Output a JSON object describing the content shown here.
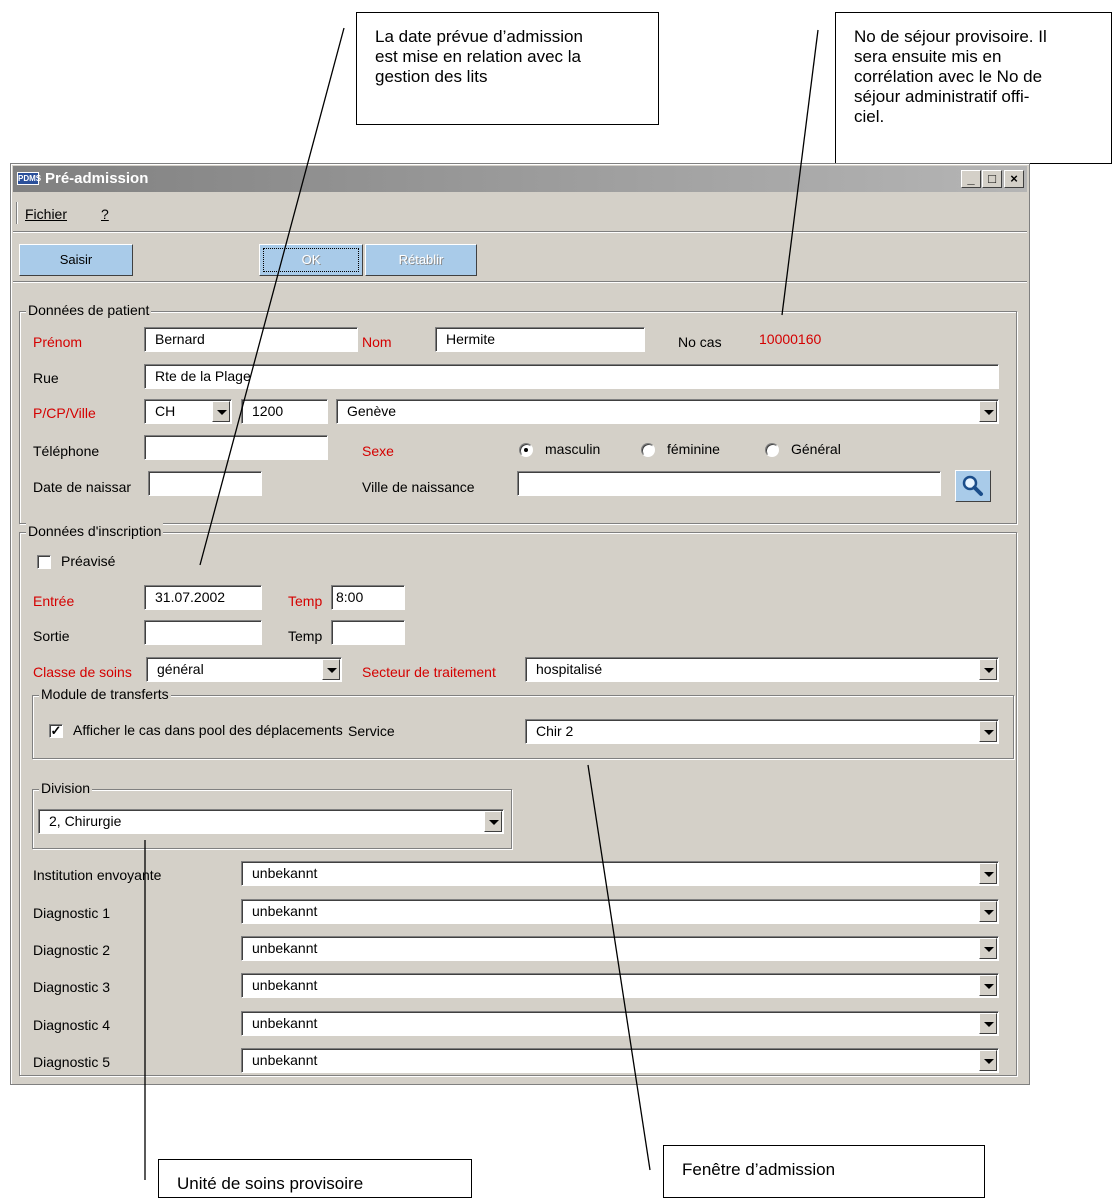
{
  "callouts": {
    "admission_date": "La date prévue d’admission\nest mise en relation avec la\ngestion des lits",
    "temp_stay": "No de séjour provisoire. Il\nsera ensuite mis en\ncorrélation avec le No de\nséjour administratif offi-\nciel.",
    "temp_unit": "Unité de soins provisoire",
    "admission_window": "Fenêtre d’admission"
  },
  "window": {
    "icon_text": "PDMS",
    "title": "Pré-admission",
    "controls": {
      "minimize": "_",
      "maximize": "□",
      "close": "×"
    }
  },
  "menu": {
    "file": "Fichier",
    "help": "?"
  },
  "toolbar": {
    "saisir": "Saisir",
    "ok": "OK",
    "retablir": "Rétablir"
  },
  "patient": {
    "legend": "Données de patient",
    "prenom_label": "Prénom",
    "prenom_value": "Bernard",
    "nom_label": "Nom",
    "nom_value": "Hermite",
    "nocas_label": "No cas",
    "nocas_value": "10000160",
    "rue_label": "Rue",
    "rue_value": "Rte de la Plage",
    "pcpville_label": "P/CP/Ville",
    "country": "CH",
    "postal_code": "1200",
    "city": "Genève",
    "telephone_label": "Téléphone",
    "telephone_value": "",
    "sexe_label": "Sexe",
    "sexe_options": [
      "masculin",
      "féminine",
      "Général"
    ],
    "sexe_selected": "masculin",
    "dob_label": "Date de naissar",
    "dob_value": "",
    "birthplace_label": "Ville de naissance",
    "birthplace_value": ""
  },
  "inscription": {
    "legend": "Données d'inscription",
    "preavise_label": "Préavisé",
    "preavise_checked": false,
    "entree_label": "Entrée",
    "entree_value": "31.07.2002",
    "entree_temp_label": "Temp",
    "entree_temp_value": "8:00",
    "sortie_label": "Sortie",
    "sortie_value": "",
    "sortie_temp_label": "Temp",
    "sortie_temp_value": "",
    "classe_label": "Classe de soins",
    "classe_value": "général",
    "secteur_label": "Secteur de traitement",
    "secteur_value": "hospitalisé",
    "transfer": {
      "legend": "Module de transferts",
      "pool_label": "Afficher le cas dans pool des déplacements",
      "pool_checked": true,
      "service_label": "Service",
      "service_value": "Chir 2"
    }
  },
  "division": {
    "legend": "Division",
    "value": "2, Chirurgie"
  },
  "lower_fields": [
    {
      "label": "Institution envoyante",
      "value": "unbekannt"
    },
    {
      "label": "Diagnostic 1",
      "value": "unbekannt"
    },
    {
      "label": "Diagnostic 2",
      "value": "unbekannt"
    },
    {
      "label": "Diagnostic 3",
      "value": "unbekannt"
    },
    {
      "label": "Diagnostic 4",
      "value": "unbekannt"
    },
    {
      "label": "Diagnostic 5",
      "value": "unbekannt"
    }
  ]
}
